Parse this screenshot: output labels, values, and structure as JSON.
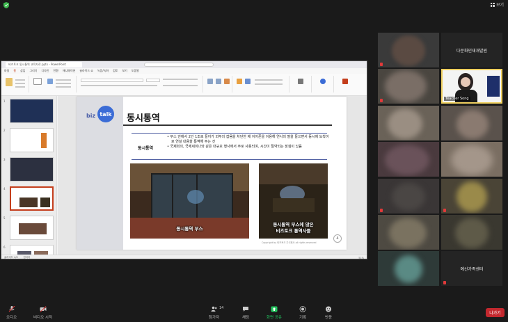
{
  "top": {
    "view_label": "보기",
    "shield_color": "#3fb950"
  },
  "ppt": {
    "tab_title": "비즈토크 동시통역 교육자료.pptx - PowerPoint",
    "menu": [
      "파일",
      "홈",
      "삽입",
      "그리기",
      "디자인",
      "전환",
      "애니메이션",
      "슬라이드 쇼",
      "녹음/녹화",
      "검토",
      "보기",
      "도움말"
    ],
    "active_menu_index": 1,
    "slide_numbers": [
      "1",
      "2",
      "3",
      "4",
      "5",
      "6"
    ],
    "selected_slide": 4,
    "status_left": "슬라이드 4/6",
    "status_lang": "한국어",
    "status_zoom": "51%"
  },
  "slide": {
    "logo_biz": "biz",
    "logo_talk": "talk",
    "title": "동시통역",
    "term": "동시통역",
    "bullets": [
      "부스 안에서 2인 1조로 들어가 외부의 잡음을 차단한 채 이어폰을 이용해 연사의 말을 들으면서 동시에 도착어로 연설 내용을 통역해 주는 것",
      "국제회의, 국제세미나와 같은 대규모 행사에서 주로 사용되며, 시간이 절약되는 장점이 있음"
    ],
    "caption1": "동시통역 부스",
    "caption2_line1": "동시통역 부스에 앉은",
    "caption2_line2": "비즈토크 통역사들",
    "copyright": "Copyright by 비즈토크 주식회사 all rights reserved",
    "page_number": "4"
  },
  "gallery": {
    "tile_names": [
      "다문화인재개발원",
      "예산가족센터"
    ],
    "teacher_label": "Teacher Song",
    "accent": "#f0d060"
  },
  "toolbar": {
    "audio": "오디오",
    "video": "비디오 시작",
    "participants": "참가자",
    "participants_count": "14",
    "chat": "채팅",
    "share": "화면 공유",
    "record": "기록",
    "reactions": "반응",
    "leave": "나가기",
    "share_color": "#22c55e",
    "leave_color": "#c3282e"
  }
}
